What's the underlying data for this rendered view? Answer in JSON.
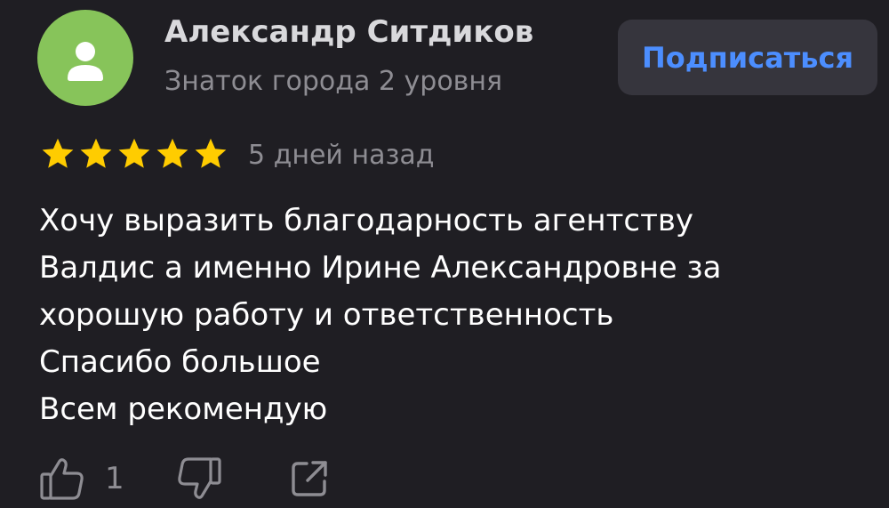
{
  "author": {
    "name": "Александр Ситдиков",
    "level": "Знаток города 2 уровня",
    "avatar_icon": "user-silhouette-icon",
    "avatar_color": "#87c45a"
  },
  "subscribe_button": {
    "label": "Подписаться",
    "color": "#4c8eff"
  },
  "rating": {
    "stars": 5,
    "max": 5,
    "star_color": "#ffcc00",
    "date": "5 дней назад"
  },
  "review": {
    "lines": [
      "Хочу выразить благодарность агентству",
      "Валдис а именно Ирине Александровне за",
      "хорошую работу и ответственность",
      "Спасибо большое",
      "Всем рекомендую"
    ]
  },
  "actions": {
    "like_icon": "thumbs-up-icon",
    "like_count": "1",
    "dislike_icon": "thumbs-down-icon",
    "share_icon": "share-icon"
  }
}
